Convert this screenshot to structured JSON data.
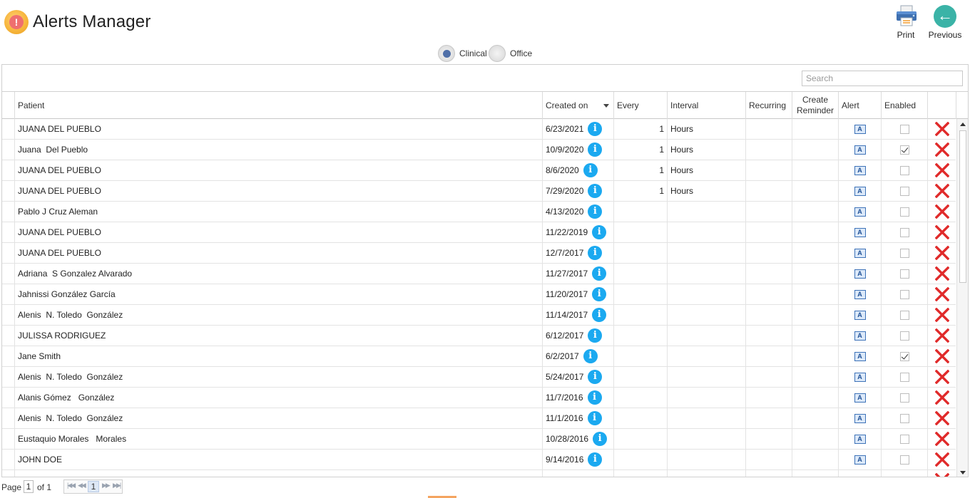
{
  "app": {
    "title": "Alerts Manager",
    "icon": "alert-exclamation-icon"
  },
  "toolbar": {
    "print_label": "Print",
    "previous_label": "Previous"
  },
  "mode": {
    "clinical_label": "Clinical",
    "office_label": "Office",
    "selected": "Clinical"
  },
  "search": {
    "placeholder": "Search",
    "value": ""
  },
  "columns": {
    "patient": "Patient",
    "created_on": "Created on",
    "every": "Every",
    "interval": "Interval",
    "recurring": "Recurring",
    "create_reminder": "Create Reminder",
    "alert": "Alert",
    "enabled": "Enabled"
  },
  "rows": [
    {
      "patient": "JUANA DEL PUEBLO",
      "created": "6/23/2021",
      "every": "1",
      "interval": "Hours",
      "enabled": false
    },
    {
      "patient": "Juana  Del Pueblo",
      "created": "10/9/2020",
      "every": "1",
      "interval": "Hours",
      "enabled": true
    },
    {
      "patient": "JUANA DEL PUEBLO",
      "created": "8/6/2020",
      "every": "1",
      "interval": "Hours",
      "enabled": false
    },
    {
      "patient": "JUANA DEL PUEBLO",
      "created": "7/29/2020",
      "every": "1",
      "interval": "Hours",
      "enabled": false
    },
    {
      "patient": "Pablo J Cruz Aleman",
      "created": "4/13/2020",
      "every": "",
      "interval": "",
      "enabled": false
    },
    {
      "patient": "JUANA DEL PUEBLO",
      "created": "11/22/2019",
      "every": "",
      "interval": "",
      "enabled": false
    },
    {
      "patient": "JUANA DEL PUEBLO",
      "created": "12/7/2017",
      "every": "",
      "interval": "",
      "enabled": false
    },
    {
      "patient": "Adriana  S Gonzalez Alvarado",
      "created": "11/27/2017",
      "every": "",
      "interval": "",
      "enabled": false
    },
    {
      "patient": "Jahnissi González García",
      "created": "11/20/2017",
      "every": "",
      "interval": "",
      "enabled": false
    },
    {
      "patient": "Alenis  N. Toledo  González",
      "created": "11/14/2017",
      "every": "",
      "interval": "",
      "enabled": false
    },
    {
      "patient": "JULISSA RODRIGUEZ",
      "created": "6/12/2017",
      "every": "",
      "interval": "",
      "enabled": false
    },
    {
      "patient": "Jane Smith",
      "created": "6/2/2017",
      "every": "",
      "interval": "",
      "enabled": true
    },
    {
      "patient": "Alenis  N. Toledo  González",
      "created": "5/24/2017",
      "every": "",
      "interval": "",
      "enabled": false
    },
    {
      "patient": "Alanis Gómez   González",
      "created": "11/7/2016",
      "every": "",
      "interval": "",
      "enabled": false
    },
    {
      "patient": "Alenis  N. Toledo  González",
      "created": "11/1/2016",
      "every": "",
      "interval": "",
      "enabled": false
    },
    {
      "patient": "Eustaquio Morales   Morales",
      "created": "10/28/2016",
      "every": "",
      "interval": "",
      "enabled": false
    },
    {
      "patient": "JOHN DOE",
      "created": "9/14/2016",
      "every": "",
      "interval": "",
      "enabled": false
    },
    {
      "patient": "",
      "created": "",
      "every": "",
      "interval": "",
      "enabled": false
    }
  ],
  "pager": {
    "page_label": "Page",
    "page_value": "1",
    "of_label": "of 1",
    "current": "1"
  },
  "colors": {
    "info": "#1ba9f0",
    "delete": "#e02a2a",
    "radio_on": "#4f6fa8",
    "back_button": "#3bb3a7"
  }
}
